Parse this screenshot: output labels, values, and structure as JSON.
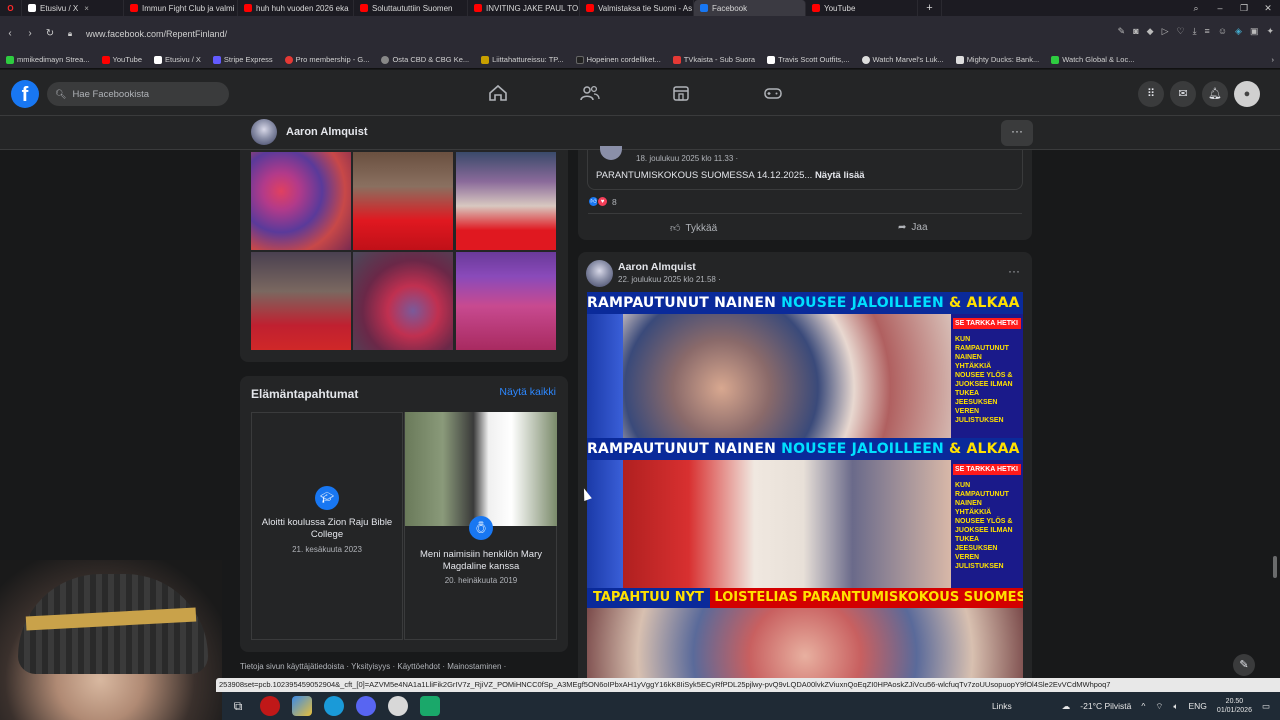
{
  "browser": {
    "tabs": [
      {
        "label": "Etusivu / X",
        "icon_color": "#ffffff"
      },
      {
        "label": "Immun Fight Club ja valmi",
        "icon_color": "#ff0000"
      },
      {
        "label": "huh huh vuoden 2026 eka",
        "icon_color": "#ff0000"
      },
      {
        "label": "Soluttaututtiin Suomen",
        "icon_color": "#ff0000"
      },
      {
        "label": "INVITING JAKE PAUL TO TI",
        "icon_color": "#ff0000"
      },
      {
        "label": "Valmistaksa tie Suomi - As",
        "icon_color": "#ff0000"
      },
      {
        "label": "Facebook",
        "icon_color": "#1877f2"
      },
      {
        "label": "YouTube",
        "icon_color": "#ff0000"
      }
    ],
    "new_tab": "+",
    "url": "www.facebook.com/RepentFinland/",
    "bookmarks": [
      {
        "label": "mmikedimayn Strea...",
        "icon_color": "#2ecc40"
      },
      {
        "label": "YouTube",
        "icon_color": "#ff0000"
      },
      {
        "label": "Etusivu / X",
        "icon_color": "#ffffff"
      },
      {
        "label": "Stripe Express",
        "icon_color": "#635bff"
      },
      {
        "label": "Pro membership - G...",
        "icon_color": "#e53935"
      },
      {
        "label": "Osta CBD & CBG Ke...",
        "icon_color": "#888888"
      },
      {
        "label": "Liittahattureissu: TP...",
        "icon_color": "#c8a000"
      },
      {
        "label": "Hopeinen cordelliket...",
        "icon_color": "#222222"
      },
      {
        "label": "TVkaista - Sub Suora",
        "icon_color": "#e53935"
      },
      {
        "label": "Travis Scott Outfits,...",
        "icon_color": "#ffffff"
      },
      {
        "label": "Watch Marvel's Luk...",
        "icon_color": "#dddddd"
      },
      {
        "label": "Mighty Ducks: Bank...",
        "icon_color": "#dddddd"
      },
      {
        "label": "Watch Global & Loc...",
        "icon_color": "#2ecc40"
      }
    ]
  },
  "facebook": {
    "search_placeholder": "Hae Facebookista",
    "profile_name": "Aaron Almquist",
    "more_label": "···",
    "life_events": {
      "title": "Elämäntapahtumat",
      "see_all": "Näytä kaikki",
      "items": [
        {
          "text": "Aloitti koulussa Zion Raju Bible College",
          "date": "21. kesäkuuta 2023"
        },
        {
          "text": "Meni naimisiin henkilön Mary Magdaline kanssa",
          "date": "20. heinäkuuta 2019"
        }
      ]
    },
    "footer": "Tietoja sivun käyttäjätiedoista · Yksityisyys · Käyttöehdot · Mainostaminen ·",
    "post1": {
      "meta": "18. joulukuu 2025 klo 11.33 · ",
      "text": "PARANTUMISKOKOUS SUOMESSA 14.12.2025...",
      "see_more": "Näytä lisää",
      "reaction_count": "8",
      "like_label": "Tykkää",
      "share_label": "Jaa"
    },
    "post2": {
      "author": "Aaron Almquist",
      "meta": "22. joulukuu 2025 klo 21.58 · ",
      "more": "···",
      "banner_parts": [
        "RAMPAUTUNUT NAINEN ",
        "NOUSEE JALOILLEEN",
        " & ALKAA JUOSTA"
      ],
      "side_highlight": "SE TARKKA HETKI",
      "side_text_1": "KUN RAMPAUTUNUT NAINEN YHTÄKKIÄ NOUSEE YLÖS & JUOKSEE ILMAN TUKEA JEESUKSEN VEREN JULISTUKSEN",
      "side_text_2": "KUN RAMPAUTUNUT NAINEN YHTÄKKIÄ NOUSEE YLÖS & JUOKSEE ILMAN TUKEA JEESUKSEN VEREN JULISTUKSEN",
      "live_tag": "TAPAHTUU NYT",
      "live_text": "LOISTELIAS PARANTUMISKOKOUS SUOMESSA"
    }
  },
  "status_url": "253908set=pcb.102395459052904&_cft_[0]=AZVM5e4NA1a1LliFik2GrIV7z_RjiVZ_POMiHNCC0fSp_A3MEgf5ON6oIPbxAH1yVggY16kK8IiSyk5ECyRfPDL25pjlwy-pvQ9vLQDA00lvkZViuxnQoEqZI0HPAoskZJiVcu56-wlcfuqTv7zoUUsopuopY9fOl4Sle2EvVCdMWhpoq7",
  "taskbar": {
    "links_label": "Links",
    "weather": "-21°C  Pilvistä",
    "lang": "ENG",
    "time": "20.50",
    "date": "01/01/2026"
  }
}
